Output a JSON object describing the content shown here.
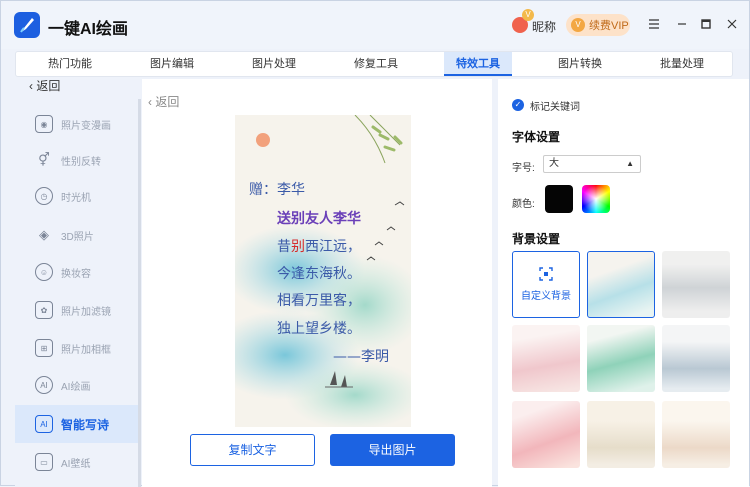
{
  "app": {
    "title": "一键AI绘画",
    "nickname": "昵称",
    "vip_badge": "V",
    "vip_label": "续费VIP"
  },
  "tabs": [
    {
      "label": "热门功能"
    },
    {
      "label": "图片编辑"
    },
    {
      "label": "图片处理"
    },
    {
      "label": "修复工具"
    },
    {
      "label": "特效工具",
      "active": true
    },
    {
      "label": "图片转换"
    },
    {
      "label": "批量处理"
    }
  ],
  "sidebar": {
    "back_label": "返回",
    "items": [
      {
        "label": "照片变漫画",
        "icon": "face-icon"
      },
      {
        "label": "性别反转",
        "icon": "gender-icon"
      },
      {
        "label": "时光机",
        "icon": "clock-icon"
      },
      {
        "label": "3D照片",
        "icon": "layers-icon"
      },
      {
        "label": "换妆容",
        "icon": "makeup-icon"
      },
      {
        "label": "照片加滤镜",
        "icon": "filter-icon"
      },
      {
        "label": "照片加相框",
        "icon": "frame-icon"
      },
      {
        "label": "AI绘画",
        "icon": "ai-icon"
      },
      {
        "label": "智能写诗",
        "icon": "ai-poem-icon",
        "active": true
      },
      {
        "label": "AI壁纸",
        "icon": "wallpaper-icon"
      }
    ]
  },
  "main": {
    "back_label": "返回",
    "poem": {
      "dedication": "赠：李华",
      "title": "送别友人李华",
      "line1_a": "昔",
      "line1_b": "别",
      "line1_c": "西江远，",
      "line2": "今逢东海秋。",
      "line3": "相看万里客，",
      "line4": "独上望乡楼。",
      "signature": "——李明"
    },
    "copy_label": "复制文字",
    "export_label": "导出图片"
  },
  "right": {
    "mark_keywords": "标记关键词",
    "font_section": "字体设置",
    "size_label": "字号:",
    "size_value": "大",
    "color_label": "颜色:",
    "bg_section": "背景设置",
    "custom_bg": "自定义背景"
  },
  "colors": {
    "accent": "#1c63e2",
    "poem_text": "#3b5aa8",
    "poem_title": "#6a3fb8",
    "highlight": "#d62b2b"
  }
}
